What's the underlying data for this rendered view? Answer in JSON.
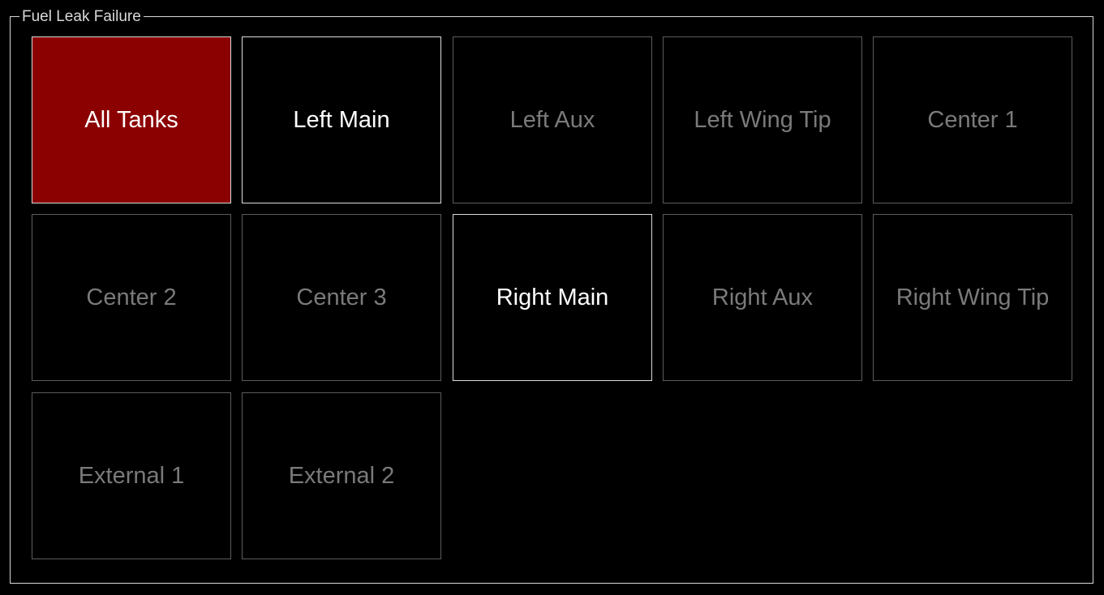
{
  "panel": {
    "title": "Fuel Leak Failure"
  },
  "tanks": [
    {
      "label": "All Tanks",
      "state": "active"
    },
    {
      "label": "Left Main",
      "state": "enabled"
    },
    {
      "label": "Left Aux",
      "state": "disabled"
    },
    {
      "label": "Left Wing Tip",
      "state": "disabled"
    },
    {
      "label": "Center 1",
      "state": "disabled"
    },
    {
      "label": "Center 2",
      "state": "disabled"
    },
    {
      "label": "Center 3",
      "state": "disabled"
    },
    {
      "label": "Right Main",
      "state": "enabled"
    },
    {
      "label": "Right Aux",
      "state": "disabled"
    },
    {
      "label": "Right Wing Tip",
      "state": "disabled"
    },
    {
      "label": "External 1",
      "state": "disabled"
    },
    {
      "label": "External 2",
      "state": "disabled"
    }
  ],
  "colors": {
    "background": "#000000",
    "active_fill": "#8b0000",
    "enabled_border": "#dcdcdc",
    "disabled_border": "#5c5c5c",
    "disabled_text": "#7a7a7a",
    "enabled_text": "#ffffff"
  }
}
